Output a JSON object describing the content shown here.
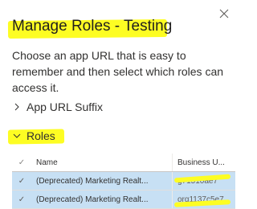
{
  "dialog": {
    "title": "Manage Roles - Testing",
    "description": "Choose an app URL that is easy to remember and then select which roles can access it."
  },
  "sections": {
    "app_url_label": "App URL Suffix",
    "roles_label": "Roles"
  },
  "grid": {
    "columns": [
      "Name",
      "Business U..."
    ],
    "rows": [
      {
        "name": "(Deprecated) Marketing Realt...",
        "business_unit": "g71510ae7",
        "selected": true
      },
      {
        "name": "(Deprecated) Marketing Realt...",
        "business_unit": "org1137c5e7",
        "selected": true
      }
    ]
  },
  "colors": {
    "highlight": "#fdfd23",
    "selected_row": "#c7e0f4",
    "text": "#323130"
  },
  "icons": {
    "close": "close-icon",
    "expand_collapsed": "chevron-right-icon",
    "expand_open": "chevron-down-icon",
    "check": "checkmark-icon"
  }
}
